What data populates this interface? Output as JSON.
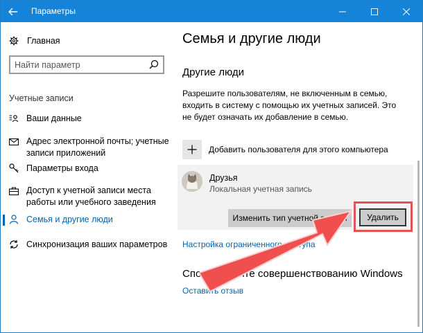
{
  "window": {
    "title": "Параметры"
  },
  "sidebar": {
    "home_label": "Главная",
    "search_placeholder": "Найти параметр",
    "section_heading": "Учетные записи",
    "items": [
      {
        "label": "Ваши данные",
        "icon": "person-card-icon"
      },
      {
        "label": "Адрес электронной почты; учетные записи приложений",
        "icon": "mail-icon"
      },
      {
        "label": "Параметры входа",
        "icon": "key-icon"
      },
      {
        "label": "Доступ к учетной записи места работы или учебного заведения",
        "icon": "briefcase-icon"
      },
      {
        "label": "Семья и другие люди",
        "icon": "person-icon",
        "active": true
      },
      {
        "label": "Синхронизация ваших параметров",
        "icon": "sync-icon"
      }
    ]
  },
  "main": {
    "page_title": "Семья и другие люди",
    "other_people_heading": "Другие люди",
    "description": "Разрешите пользователям, не включенным в семью, входить в систему с помощью их учетных записей. Это не будет означать их добавление в семью.",
    "add_user_label": "Добавить пользователя для этого компьютера",
    "account": {
      "name": "Друзья",
      "type": "Локальная учетная запись",
      "change_type_button": "Изменить тип учетной записи",
      "delete_button": "Удалить"
    },
    "restricted_access_link": "Настройка ограниченного доступа",
    "improve_heading": "Способствуйте совершенствованию Windows",
    "feedback_link": "Оставить отзыв"
  },
  "colors": {
    "title_bar": "#1583d8",
    "accent": "#0063b1",
    "highlight": "#e05552",
    "arrow": "#ef4f4f"
  }
}
